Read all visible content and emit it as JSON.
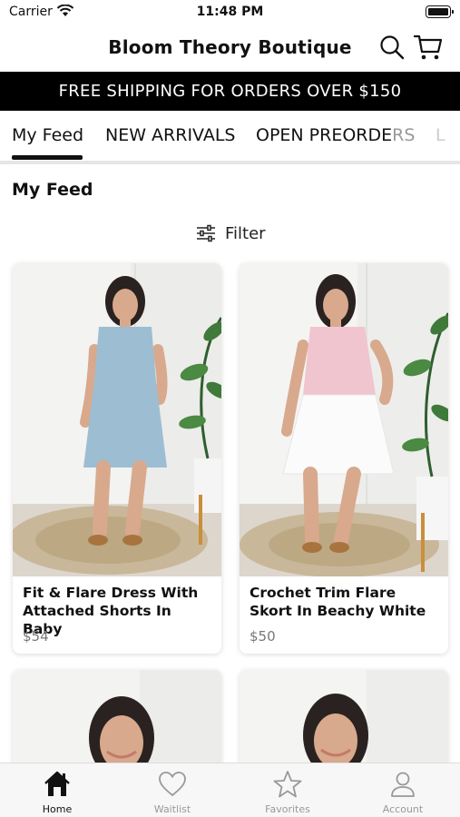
{
  "status_bar": {
    "carrier": "Carrier",
    "time": "11:48 PM"
  },
  "header": {
    "title": "Bloom Theory Boutique"
  },
  "banner": {
    "text": "FREE SHIPPING FOR ORDERS OVER $150"
  },
  "tabs": [
    {
      "label": "My Feed",
      "active": true
    },
    {
      "label": "NEW ARRIVALS"
    },
    {
      "label_main": "OPEN PREORDE",
      "label_fade": "RS"
    },
    {
      "label": "L"
    }
  ],
  "feed": {
    "title": "My Feed",
    "filter_label": "Filter"
  },
  "products": [
    {
      "name": "Fit & Flare Dress With Attached Shorts In Baby",
      "price": "$54"
    },
    {
      "name": "Crochet Trim Flare Skort In Beachy White",
      "price": "$50"
    }
  ],
  "bottom_nav": [
    {
      "label": "Home",
      "icon": "home-icon",
      "active": true
    },
    {
      "label": "Waitlist",
      "icon": "heart-icon"
    },
    {
      "label": "Favorites",
      "icon": "star-icon"
    },
    {
      "label": "Account",
      "icon": "account-icon"
    }
  ],
  "colors": {
    "banner_bg": "#000000",
    "accent": "#111111",
    "inactive_nav": "#999999"
  }
}
